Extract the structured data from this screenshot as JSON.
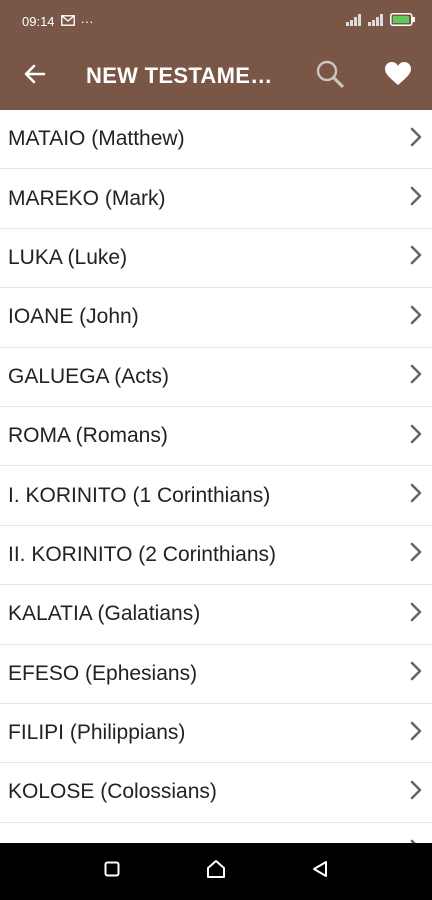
{
  "status_bar": {
    "time": "09:14",
    "overflow": "···"
  },
  "app_bar": {
    "title": "NEW TESTAME…"
  },
  "books": [
    {
      "label": "MATAIO (Matthew)"
    },
    {
      "label": "MAREKO (Mark)"
    },
    {
      "label": "LUKA (Luke)"
    },
    {
      "label": "IOANE (John)"
    },
    {
      "label": "GALUEGA (Acts)"
    },
    {
      "label": "ROMA (Romans)"
    },
    {
      "label": "I. KORINITO (1 Corinthians)"
    },
    {
      "label": "II. KORINITO (2 Corinthians)"
    },
    {
      "label": "KALATIA (Galatians)"
    },
    {
      "label": "EFESO (Ephesians)"
    },
    {
      "label": "FILIPI (Philippians)"
    },
    {
      "label": "KOLOSE (Colossians)"
    },
    {
      "label": ""
    }
  ],
  "icons": {
    "back": "arrow-left-icon",
    "search": "search-icon",
    "favorite": "heart-icon",
    "row": "chevron-right-icon",
    "nav": [
      "square-icon",
      "home-icon",
      "back-triangle-icon"
    ]
  },
  "colors": {
    "brand": "#7a5646",
    "navbar": "#000000",
    "chevron": "#666666"
  }
}
